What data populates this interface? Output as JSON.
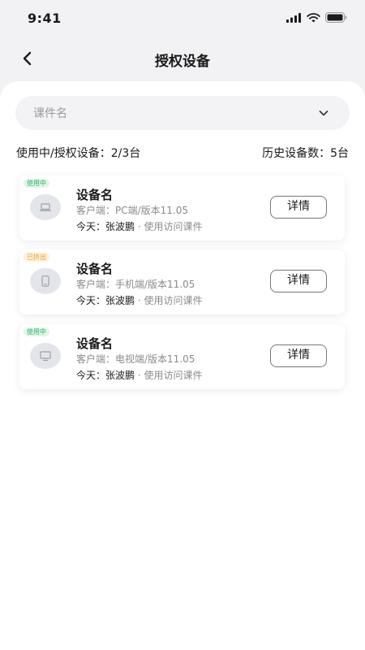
{
  "status_bar": {
    "time": "9:41"
  },
  "nav": {
    "title": "授权设备"
  },
  "filter": {
    "placeholder": "课件名"
  },
  "summary": {
    "in_use": "使用中/授权设备：2/3台",
    "history": "历史设备数：5台"
  },
  "devices": [
    {
      "status": "使用中",
      "name": "设备名",
      "client": "客户端：PC端/版本11.05",
      "day": "今天：",
      "user": "张波鹏",
      "sep": "·",
      "action": "使用访问课件",
      "detail_label": "详情",
      "icon": "laptop-icon"
    },
    {
      "status": "已挤出",
      "name": "设备名",
      "client": "客户端：手机端/版本11.05",
      "day": "今天：",
      "user": "张波鹏",
      "sep": "·",
      "action": "使用访问课件",
      "detail_label": "详情",
      "icon": "phone-icon"
    },
    {
      "status": "使用中",
      "name": "设备名",
      "client": "客户端：电视端/版本11.05",
      "day": "今天：",
      "user": "张波鹏",
      "sep": "·",
      "action": "使用访问课件",
      "detail_label": "详情",
      "icon": "tv-icon"
    }
  ],
  "colors": {
    "in_use_badge": "#2fb667",
    "kicked_badge": "#e9a23b",
    "background": "#f2f2f4"
  }
}
